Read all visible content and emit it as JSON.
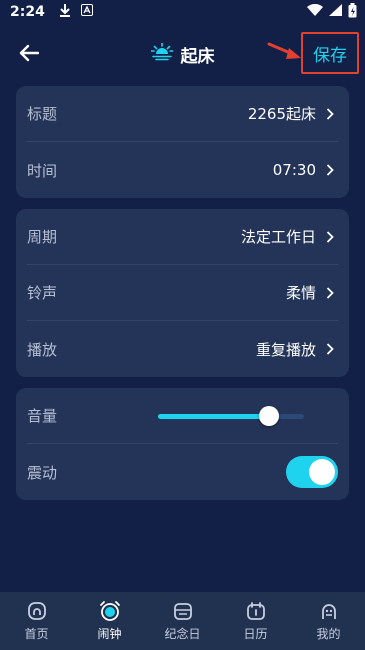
{
  "status_bar": {
    "time": "2:24"
  },
  "header": {
    "title": "起床",
    "save_label": "保存"
  },
  "settings": {
    "title_row": {
      "label": "标题",
      "value": "2265起床"
    },
    "time_row": {
      "label": "时间",
      "value": "07:30"
    },
    "cycle_row": {
      "label": "周期",
      "value": "法定工作日"
    },
    "ringtone_row": {
      "label": "铃声",
      "value": "柔情"
    },
    "playback_row": {
      "label": "播放",
      "value": "重复播放"
    },
    "volume_row": {
      "label": "音量",
      "level": 0.8
    },
    "vibrate_row": {
      "label": "震动",
      "enabled": true
    }
  },
  "tabbar": {
    "items": [
      {
        "label": "首页",
        "icon": "home-icon"
      },
      {
        "label": "闹钟",
        "icon": "alarm-clock-icon",
        "active": true
      },
      {
        "label": "纪念日",
        "icon": "anniversary-icon"
      },
      {
        "label": "日历",
        "icon": "calendar-icon"
      },
      {
        "label": "我的",
        "icon": "profile-icon"
      }
    ]
  },
  "colors": {
    "background": "#122047",
    "card": "#243458",
    "accent": "#1fd3ee",
    "highlight_border": "#e3402f"
  }
}
